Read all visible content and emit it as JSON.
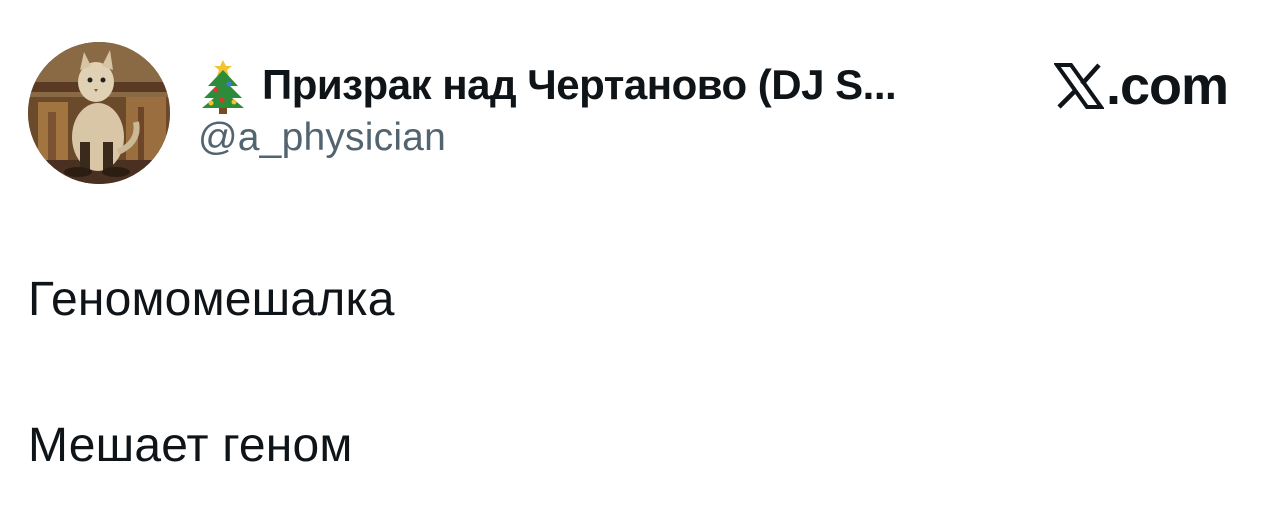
{
  "author": {
    "display_name": "Призрак над Чертаново (DJ S...",
    "handle": "@a_physician",
    "name_prefix_icon": "christmas-tree-icon",
    "avatar": "cat-painting-avatar"
  },
  "brand": {
    "logo_icon": "x-logo-icon",
    "text": ".com"
  },
  "tweet": {
    "lines": [
      "Геномомешалка",
      "Мешает геном"
    ]
  },
  "colors": {
    "text_primary": "#0f1419",
    "text_secondary": "#536471",
    "background": "#ffffff"
  }
}
